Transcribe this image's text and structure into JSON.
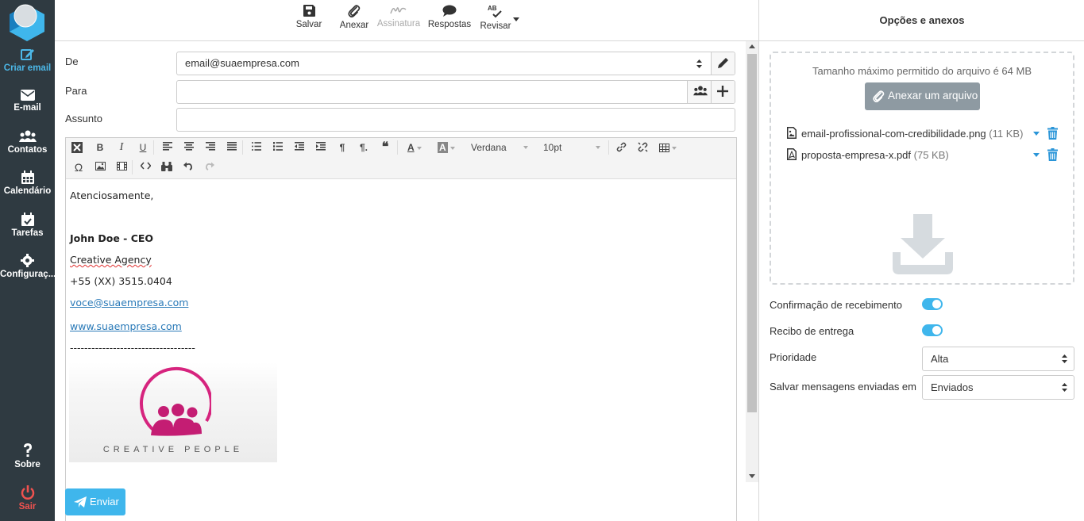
{
  "sidebar": {
    "items": [
      {
        "label": "Criar email",
        "icon": "edit-icon"
      },
      {
        "label": "E-mail",
        "icon": "envelope-icon"
      },
      {
        "label": "Contatos",
        "icon": "users-icon"
      },
      {
        "label": "Calendário",
        "icon": "calendar-icon"
      },
      {
        "label": "Tarefas",
        "icon": "calendar-check-icon"
      },
      {
        "label": "Configuraç...",
        "icon": "gear-icon"
      }
    ],
    "bottom": [
      {
        "label": "Sobre",
        "icon": "question-icon"
      },
      {
        "label": "Sair",
        "icon": "power-icon"
      }
    ]
  },
  "toolbar": {
    "save_label": "Salvar",
    "attach_label": "Anexar",
    "signature_label": "Assinatura",
    "responses_label": "Respostas",
    "review_label": "Revisar"
  },
  "compose": {
    "from_label": "De",
    "from_value": "email@suaempresa.com",
    "to_label": "Para",
    "to_value": "",
    "subject_label": "Assunto",
    "subject_value": ""
  },
  "editor_toolbar": {
    "font_family": "Verdana",
    "font_size": "10pt"
  },
  "body": {
    "greeting": "Atenciosamente,",
    "name": "John Doe - CEO",
    "company": "Creative Agency",
    "phone": "+55 (XX) 3515.0404",
    "email": "voce@suaempresa.com",
    "website": "www.suaempresa.com",
    "divider": "-----------------------------------",
    "logo_text": "CREATIVE PEOPLE"
  },
  "send_label": "Enviar",
  "right_panel": {
    "title": "Opções e anexos",
    "max_size_text": "Tamanho máximo permitido do arquivo é 64 MB",
    "attach_button": "Anexar um arquivo",
    "files": [
      {
        "name": "email-profissional-com-credibilidade.png",
        "size": "(11 KB)"
      },
      {
        "name": "proposta-empresa-x.pdf",
        "size": "(75 KB)"
      }
    ],
    "options": {
      "read_receipt_label": "Confirmação de recebimento",
      "read_receipt_on": true,
      "delivery_receipt_label": "Recibo de entrega",
      "delivery_receipt_on": true,
      "priority_label": "Prioridade",
      "priority_value": "Alta",
      "save_sent_label": "Salvar mensagens enviadas em",
      "save_sent_value": "Enviados"
    }
  },
  "colors": {
    "sidebar_bg": "#2f3a41",
    "accent": "#3fb6ec",
    "danger": "#f0524f",
    "logo_magenta": "#d6247e"
  }
}
